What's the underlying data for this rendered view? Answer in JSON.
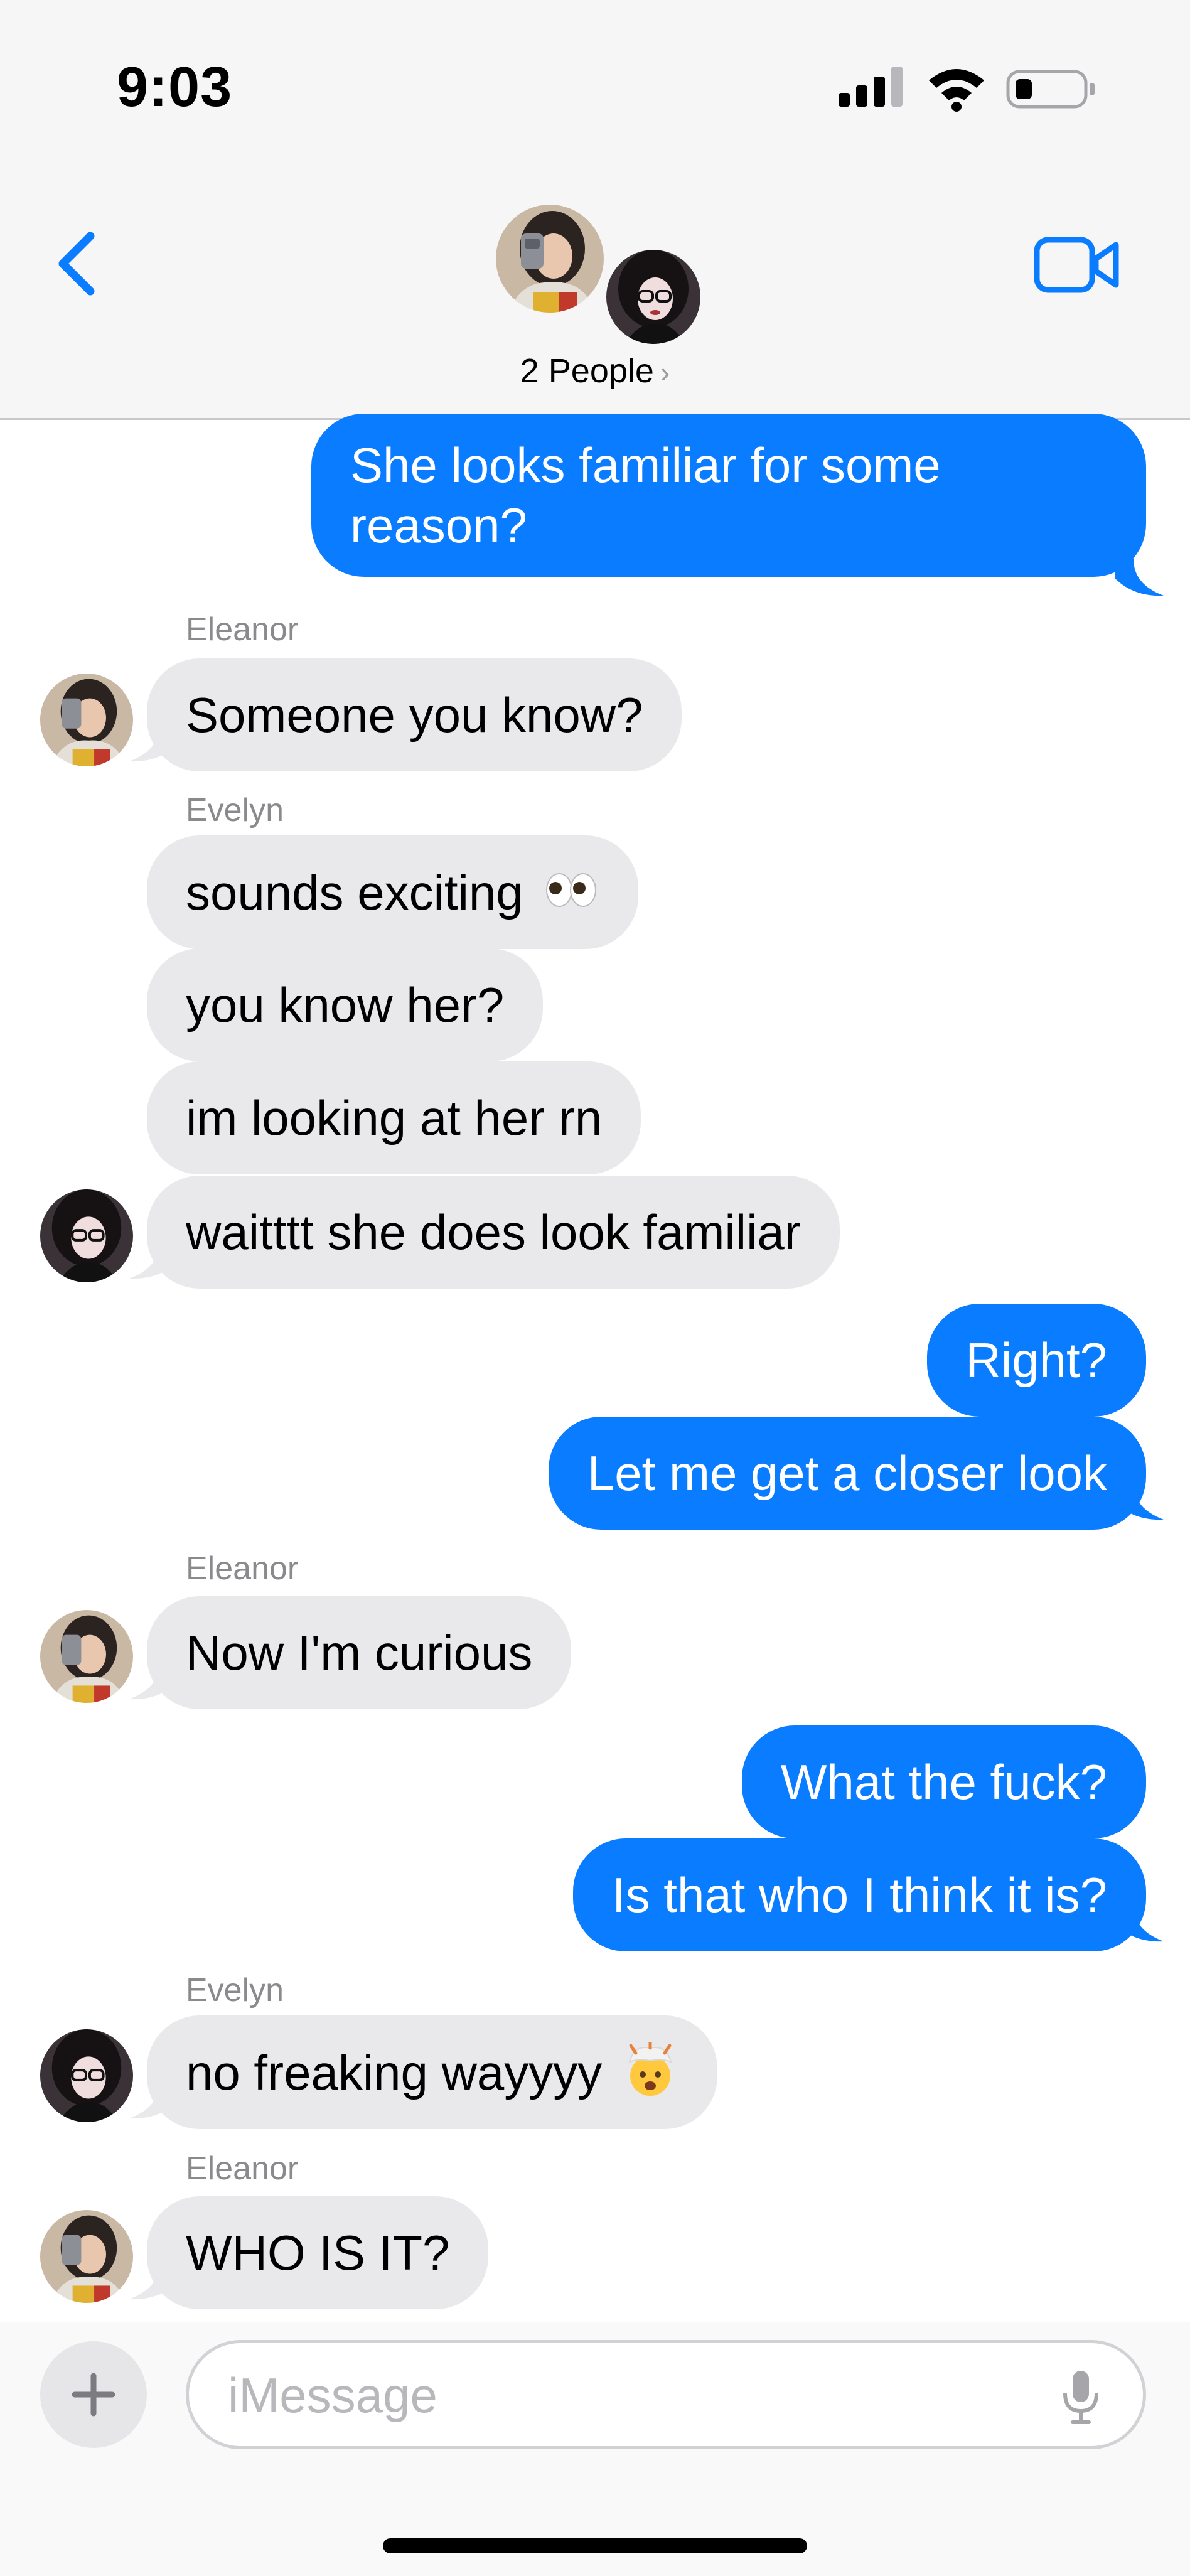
{
  "status_bar": {
    "time": "9:03",
    "icons": [
      "cellular-signal-icon",
      "wifi-icon",
      "battery-icon"
    ]
  },
  "header": {
    "back_icon": "chevron-left-icon",
    "participants_label": "2 People",
    "video_icon": "video-camera-icon",
    "accent_color": "#0a7cff"
  },
  "messages": [
    {
      "from": "me",
      "text": "She looks familiar for some reason?"
    },
    {
      "from": "Eleanor",
      "sender_label": "Eleanor",
      "text": "Someone you know?"
    },
    {
      "from": "Evelyn",
      "sender_label": "Evelyn",
      "text": "sounds exciting",
      "emoji": "eyes"
    },
    {
      "from": "Evelyn",
      "text": "you know her?"
    },
    {
      "from": "Evelyn",
      "text": "im looking at her rn"
    },
    {
      "from": "Evelyn",
      "text": "waitttt she does look familiar"
    },
    {
      "from": "me",
      "text": "Right?"
    },
    {
      "from": "me",
      "text": "Let me get a closer look"
    },
    {
      "from": "Eleanor",
      "sender_label": "Eleanor",
      "text": "Now I'm curious"
    },
    {
      "from": "me",
      "text": "What the fuck?"
    },
    {
      "from": "me",
      "text": "Is that who I think it is?"
    },
    {
      "from": "Evelyn",
      "sender_label": "Evelyn",
      "text": "no freaking wayyyy",
      "emoji": "exploding-head"
    },
    {
      "from": "Eleanor",
      "sender_label": "Eleanor",
      "text": "WHO IS IT?"
    }
  ],
  "composer": {
    "placeholder": "iMessage",
    "value": "",
    "plus_icon": "plus-icon",
    "mic_icon": "microphone-icon"
  },
  "colors": {
    "outgoing_bubble": "#0a7cff",
    "incoming_bubble": "#e9e9eb",
    "header_background": "#f6f6f6"
  }
}
